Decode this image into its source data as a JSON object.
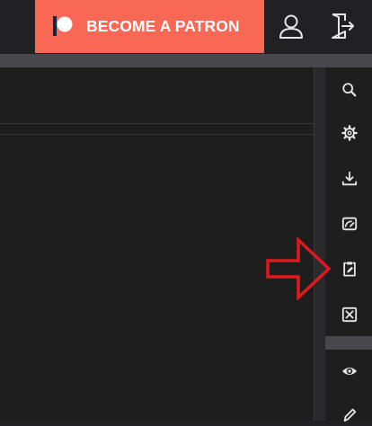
{
  "patreon": {
    "label": "BECOME A PATRON",
    "color": "#f96854"
  },
  "header_icons": [
    "user-icon",
    "logout-icon"
  ],
  "side_tools": [
    {
      "icon": "search-icon"
    },
    {
      "icon": "gear-icon"
    },
    {
      "icon": "download-icon"
    },
    {
      "icon": "gauge-icon"
    },
    {
      "icon": "clipboard-edit-icon"
    },
    {
      "icon": "close-box-icon"
    },
    {
      "icon": "eye-icon"
    },
    {
      "icon": "pencil-icon"
    }
  ],
  "annotation": {
    "arrow_color": "#e0191f"
  }
}
